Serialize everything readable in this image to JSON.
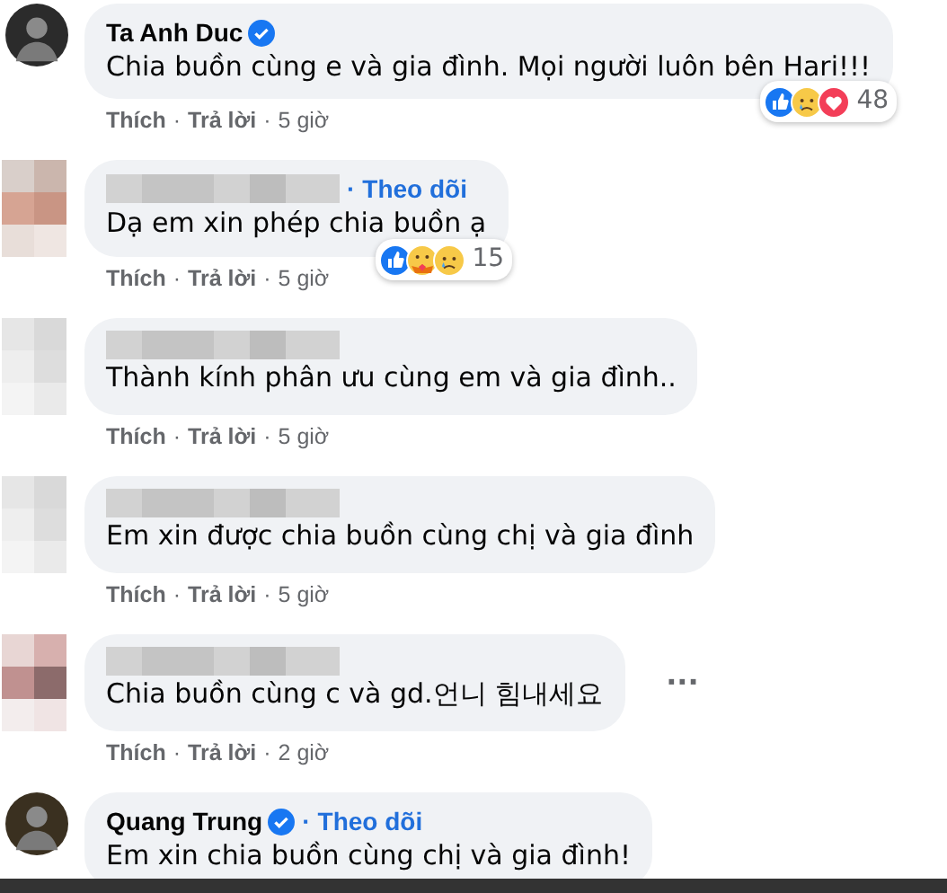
{
  "comments": [
    {
      "author": {
        "kind": "named",
        "name": "Ta Anh Duc",
        "verified": true
      },
      "avatar": {
        "kind": "person"
      },
      "text": "Chia buồn cùng e và gia đình. Mọi người luôn bên Hari!!!",
      "reactions": {
        "icons": [
          {
            "kind": "like"
          },
          {
            "kind": "sad"
          },
          {
            "kind": "love"
          }
        ],
        "count": "48"
      },
      "actions": {
        "like": "Thích",
        "sep1": "·",
        "reply": "Trả lời",
        "sep2": "·",
        "time": "5 giờ"
      }
    },
    {
      "author": {
        "kind": "blurred",
        "sep": "·",
        "follow": "Theo dõi"
      },
      "avatar": {
        "kind": "pixelated"
      },
      "text": "Dạ em xin phép chia buồn ạ",
      "reactions": {
        "icons": [
          {
            "kind": "like"
          },
          {
            "kind": "care"
          },
          {
            "kind": "sad"
          }
        ],
        "count": "15"
      },
      "actions": {
        "like": "Thích",
        "sep1": "·",
        "reply": "Trả lời",
        "sep2": "·",
        "time": "5 giờ"
      }
    },
    {
      "author": {
        "kind": "blurred"
      },
      "avatar": {
        "kind": "pixelated"
      },
      "text": "Thành kính phân ưu cùng em và gia đình..",
      "actions": {
        "like": "Thích",
        "sep1": "·",
        "reply": "Trả lời",
        "sep2": "·",
        "time": "5 giờ"
      }
    },
    {
      "author": {
        "kind": "blurred"
      },
      "avatar": {
        "kind": "pixelated"
      },
      "text": "Em xin được chia buồn cùng chị và gia đình",
      "actions": {
        "like": "Thích",
        "sep1": "·",
        "reply": "Trả lời",
        "sep2": "·",
        "time": "5 giờ"
      }
    },
    {
      "author": {
        "kind": "blurred"
      },
      "avatar": {
        "kind": "pixelated"
      },
      "text": "Chia buồn cùng c và gd.언니 힘내세요",
      "menu": "···",
      "actions": {
        "like": "Thích",
        "sep1": "·",
        "reply": "Trả lời",
        "sep2": "·",
        "time": "2 giờ"
      }
    },
    {
      "author": {
        "kind": "named",
        "name": "Quang Trung",
        "verified": true,
        "sep": "·",
        "follow": "Theo dõi"
      },
      "avatar": {
        "kind": "person"
      },
      "text": "Em xin chia buồn cùng chị và gia đình!"
    }
  ]
}
